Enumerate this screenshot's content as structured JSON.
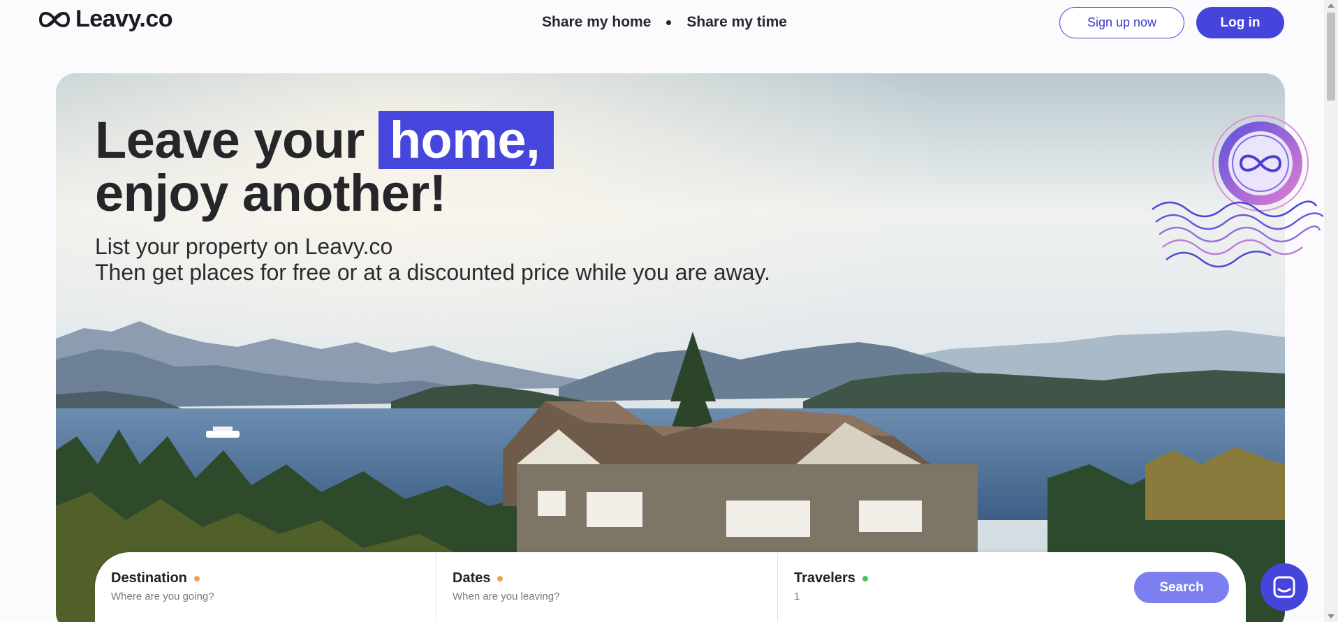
{
  "header": {
    "logo_text": "Leavy.co",
    "nav": [
      "Share my home",
      "Share my time"
    ],
    "signup_label": "Sign up now",
    "login_label": "Log in"
  },
  "hero": {
    "headline_part1": "Leave your",
    "headline_highlight": "home,",
    "headline_line2": "enjoy another!",
    "sub_line1": "List your property on Leavy.co",
    "sub_line2": "Then get places for free or at a discounted price while you are away."
  },
  "search": {
    "destination_label": "Destination",
    "destination_placeholder": "Where are you going?",
    "dates_label": "Dates",
    "dates_placeholder": "When are you leaving?",
    "travelers_label": "Travelers",
    "travelers_value": "1",
    "search_label": "Search"
  },
  "colors": {
    "accent": "#4545dc",
    "search_button": "#7b7ff0",
    "dot_orange": "#f0a35a",
    "dot_green": "#3ecb55"
  },
  "icons": [
    "leavy-logo-icon",
    "stamp-icon",
    "chat-icon"
  ]
}
